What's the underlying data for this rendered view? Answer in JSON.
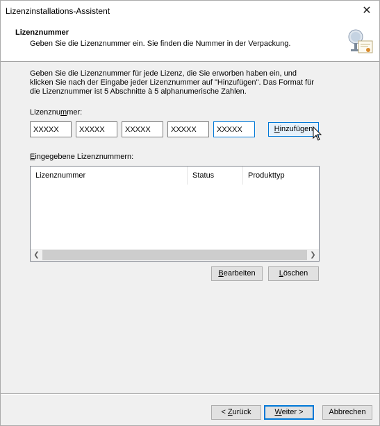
{
  "window": {
    "title": "Lizenzinstallations-Assistent",
    "close_glyph": "✕"
  },
  "header": {
    "title": "Lizenznummer",
    "subtitle": "Geben Sie die Lizenznummer ein. Sie finden die Nummer in der Verpackung.",
    "icon": "certificate-icon"
  },
  "intro_text": "Geben Sie die Lizenznummer für jede Lizenz, die Sie erworben haben ein, und klicken Sie nach der Eingabe jeder Lizenznummer auf \"Hinzufügen\". Das Format für die Lizenznummer ist 5 Abschnitte à 5 alphanumerische Zahlen.",
  "license_input": {
    "label_pre": "Lizenznu",
    "label_accel": "m",
    "label_post": "mer:",
    "segments": [
      "XXXXX",
      "XXXXX",
      "XXXXX",
      "XXXXX",
      "XXXXX"
    ],
    "add_button": {
      "accel": "H",
      "rest": "inzufügen"
    }
  },
  "entered": {
    "label_accel": "E",
    "label_rest": "ingegebene Lizenznummern:",
    "columns": [
      "Lizenznummer",
      "Status",
      "Produkttyp"
    ],
    "rows": []
  },
  "actions": {
    "edit": {
      "accel": "B",
      "rest": "earbeiten"
    },
    "delete": {
      "accel": "L",
      "rest": "öschen"
    }
  },
  "footer": {
    "back": {
      "pre": "< ",
      "accel": "Z",
      "rest": "urück"
    },
    "next": {
      "accel": "W",
      "rest": "eiter >"
    },
    "cancel": "Abbrechen"
  }
}
